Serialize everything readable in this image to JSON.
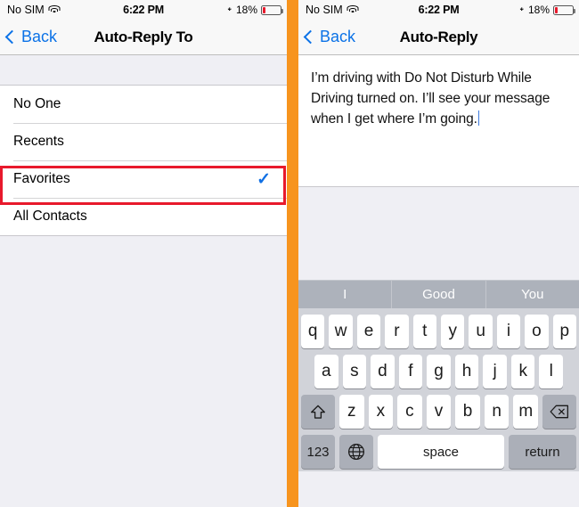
{
  "left": {
    "status": {
      "carrier": "No SIM",
      "wifi_icon": "wifi-icon",
      "time": "6:22 PM",
      "bluetooth_icon": "bluetooth-icon",
      "battery_percent": "18%",
      "battery_level": 18
    },
    "nav": {
      "back_label": "Back",
      "back_icon": "chevron-left-icon",
      "title": "Auto-Reply To"
    },
    "options": [
      {
        "label": "No One",
        "selected": false
      },
      {
        "label": "Recents",
        "selected": false
      },
      {
        "label": "Favorites",
        "selected": true
      },
      {
        "label": "All Contacts",
        "selected": false
      }
    ],
    "checkmark": "✓",
    "highlight_color": "#E8192C"
  },
  "divider_color": "#F7941E",
  "right": {
    "status": {
      "carrier": "No SIM",
      "wifi_icon": "wifi-icon",
      "time": "6:22 PM",
      "bluetooth_icon": "bluetooth-icon",
      "battery_percent": "18%",
      "battery_level": 18
    },
    "nav": {
      "back_label": "Back",
      "back_icon": "chevron-left-icon",
      "title": "Auto-Reply"
    },
    "compose": {
      "message": "I’m driving with Do Not Disturb While Driving turned on. I’ll see your message when I get where I’m going."
    },
    "keyboard": {
      "predictions": [
        "I",
        "Good",
        "You"
      ],
      "row1": [
        "q",
        "w",
        "e",
        "r",
        "t",
        "y",
        "u",
        "i",
        "o",
        "p"
      ],
      "row2": [
        "a",
        "s",
        "d",
        "f",
        "g",
        "h",
        "j",
        "k",
        "l"
      ],
      "row3": [
        "z",
        "x",
        "c",
        "v",
        "b",
        "n",
        "m"
      ],
      "shift_icon": "shift-icon",
      "delete_icon": "backspace-icon",
      "numbers_label": "123",
      "globe_icon": "globe-icon",
      "space_label": "space",
      "return_label": "return"
    }
  },
  "accent_blue": "#0B72E7"
}
